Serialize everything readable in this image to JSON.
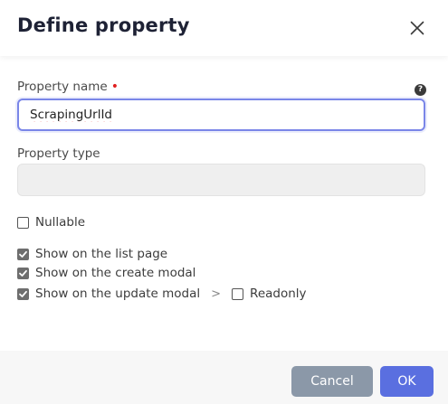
{
  "modal": {
    "title": "Define property",
    "close_icon": "close-icon"
  },
  "form": {
    "property_name": {
      "label": "Property name",
      "required_marker": "•",
      "help_icon": "?",
      "value": "ScrapingUrlId"
    },
    "property_type": {
      "label": "Property type",
      "value": ""
    },
    "nullable": {
      "label": "Nullable",
      "checked": false
    },
    "show_on_list": {
      "label": "Show on the list page",
      "checked": true
    },
    "show_on_create": {
      "label": "Show on the create modal",
      "checked": true
    },
    "show_on_update": {
      "label": "Show on the update modal",
      "checked": true
    },
    "separator": ">",
    "readonly": {
      "label": "Readonly",
      "checked": false
    }
  },
  "footer": {
    "cancel_label": "Cancel",
    "ok_label": "OK"
  },
  "colors": {
    "primary": "#5a6fe0",
    "secondary": "#8b98a8",
    "focus_border": "#7a86e8",
    "required": "#e02020"
  }
}
